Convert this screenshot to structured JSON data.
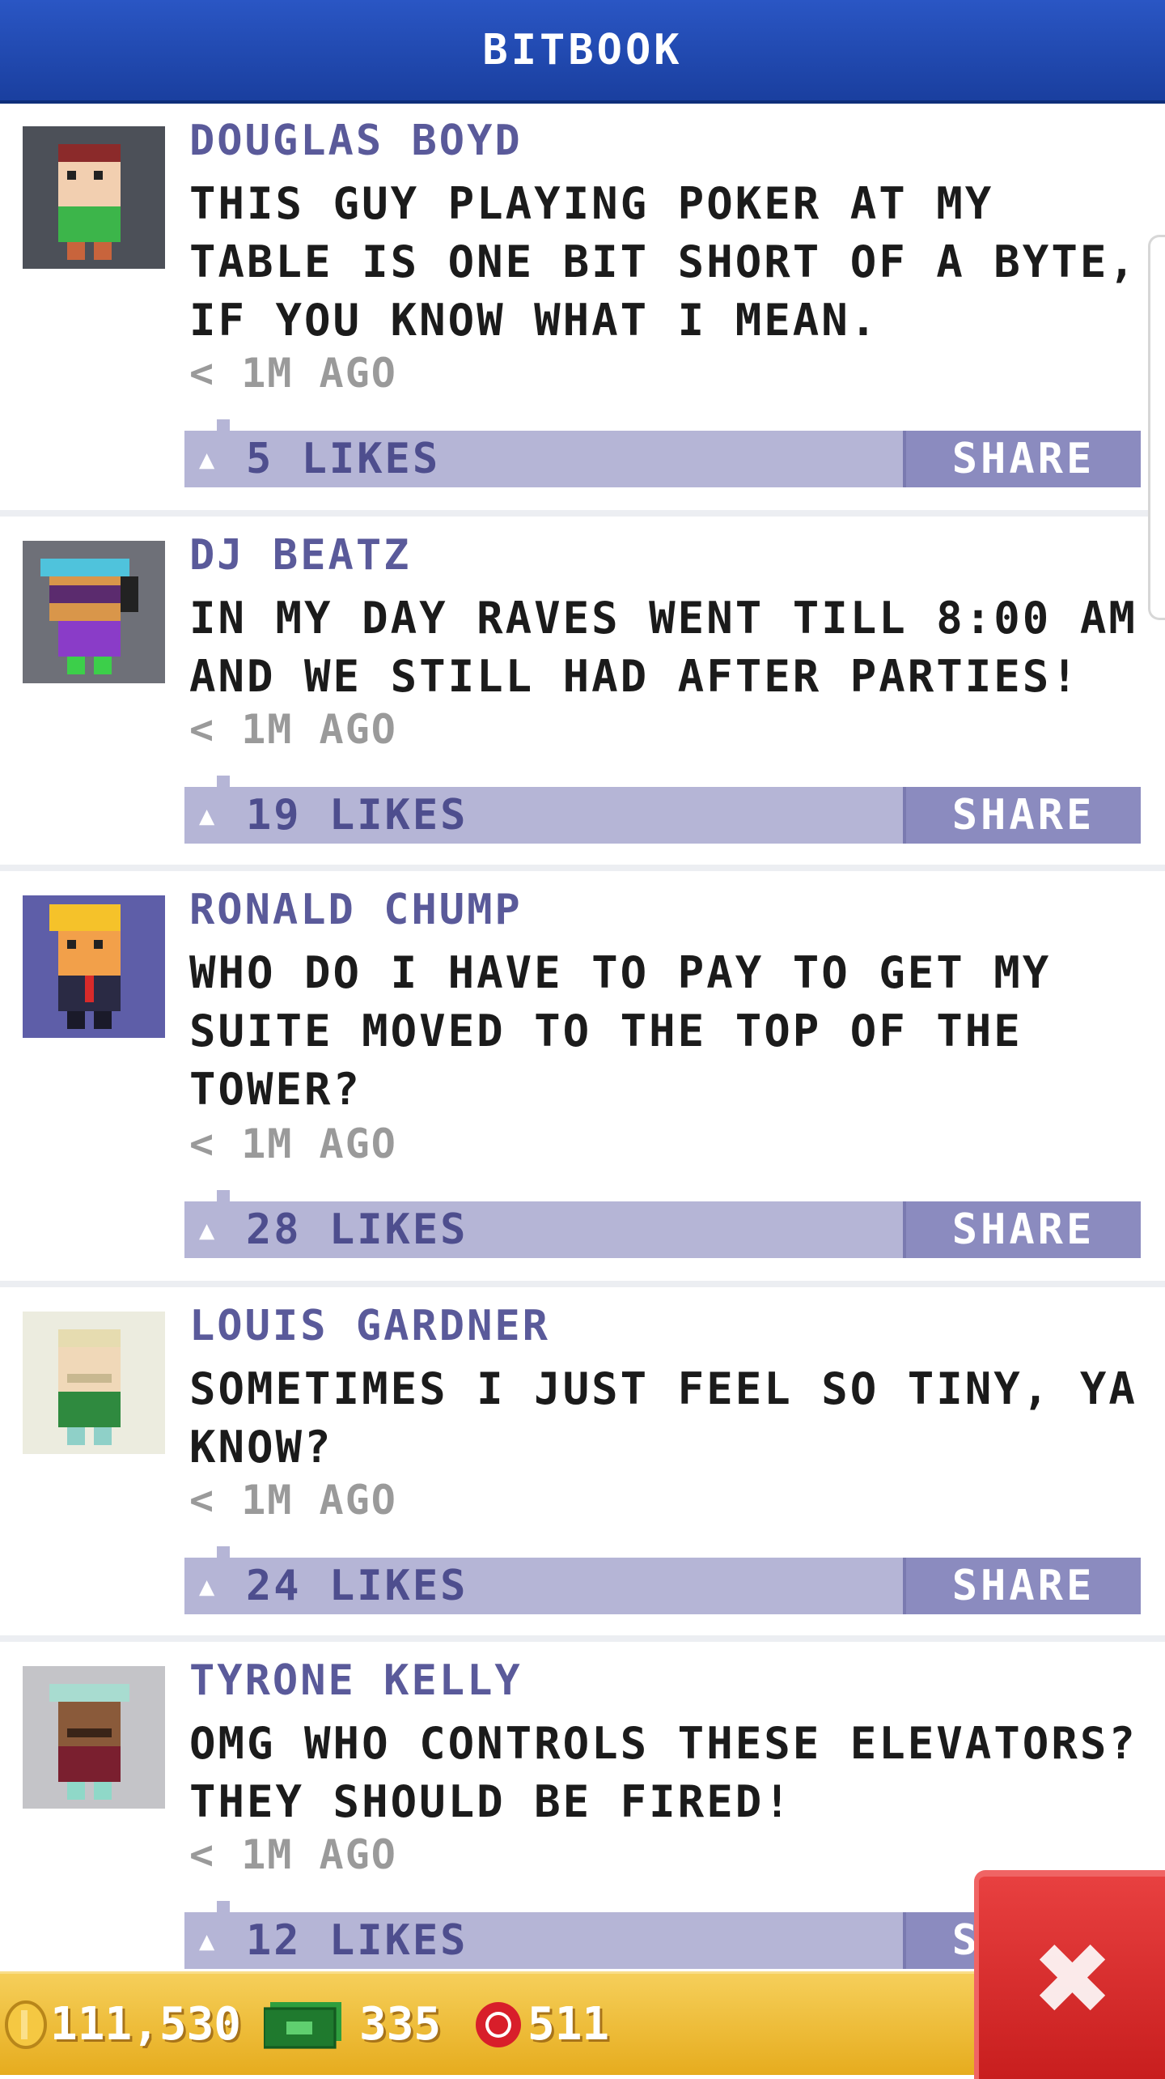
{
  "header": {
    "title": "BITBOOK"
  },
  "posts": [
    {
      "name": "DOUGLAS BOYD",
      "message": "THIS GUY PLAYING POKER AT MY TABLE IS ONE BIT SHORT OF A BYTE, IF YOU KNOW WHAT I MEAN.",
      "time": "< 1M AGO",
      "likes": "5 LIKES",
      "share": "SHARE"
    },
    {
      "name": "DJ BEATZ",
      "message": "IN MY DAY RAVES WENT TILL 8:00 AM AND WE STILL HAD AFTER PARTIES!",
      "time": "< 1M AGO",
      "likes": "19 LIKES",
      "share": "SHARE"
    },
    {
      "name": "RONALD CHUMP",
      "message": "WHO DO I HAVE TO PAY TO GET MY SUITE MOVED TO THE TOP OF THE TOWER?",
      "time": "< 1M AGO",
      "likes": "28 LIKES",
      "share": "SHARE"
    },
    {
      "name": "LOUIS GARDNER",
      "message": "SOMETIMES I JUST FEEL SO TINY, YA KNOW?",
      "time": "< 1M AGO",
      "likes": "24 LIKES",
      "share": "SHARE"
    },
    {
      "name": "TYRONE KELLY",
      "message": "OMG WHO CONTROLS THESE ELEVATORS? THEY SHOULD BE FIRED!",
      "time": "< 1M AGO",
      "likes": "12 LIKES",
      "share": "SHARE"
    }
  ],
  "footer": {
    "coins": "111,530",
    "bux": "335",
    "chips": "511"
  },
  "close_icon": "close-icon",
  "colors": {
    "header": "#1f4bb4",
    "name": "#5a5a9a",
    "like_bar": "#b5b5d6",
    "share": "#8b8bbf",
    "footer": "#f0bf3a",
    "close": "#d82a2a"
  }
}
